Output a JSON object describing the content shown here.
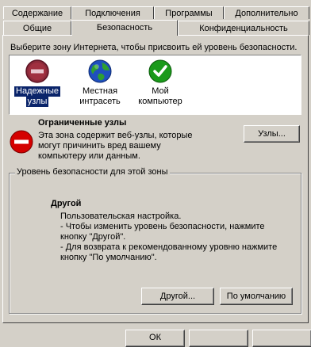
{
  "tabs_row1": [
    {
      "label": "Содержание"
    },
    {
      "label": "Подключения"
    },
    {
      "label": "Программы"
    },
    {
      "label": "Дополнительно"
    }
  ],
  "tabs_row2": [
    {
      "label": "Общие"
    },
    {
      "label": "Безопасность",
      "active": true
    },
    {
      "label": "Конфиденциальность"
    }
  ],
  "instruction": "Выберите зону Интернета, чтобы присвоить ей уровень безопасности.",
  "zones": [
    {
      "label_line1": "Надежные",
      "label_line2": "узлы",
      "icon": "restricted-sites-icon",
      "selected": true
    },
    {
      "label_line1": "Местная",
      "label_line2": "интрасеть",
      "icon": "globe-icon"
    },
    {
      "label_line1": "Мой",
      "label_line2": "компьютер",
      "icon": "checkmark-icon"
    }
  ],
  "zone_info": {
    "title": "Ограниченные узлы",
    "desc_line1": "Эта зона содержит веб-узлы, которые",
    "desc_line2": "могут причинить вред вашему",
    "desc_line3": "компьютеру или данным.",
    "sites_button": "Узлы..."
  },
  "security_level": {
    "group_title": "Уровень безопасности для этой зоны",
    "level_name": "Другой",
    "line1": "Пользовательская настройка.",
    "line2": "- Чтобы изменить уровень безопасности, нажмите",
    "line3": "кнопку \"Другой\".",
    "line4": "- Для возврата к рекомендованному уровню нажмите",
    "line5": "кнопку \"По умолчанию\".",
    "custom_button": "Другой...",
    "default_button": "По умолчанию"
  },
  "bottom_buttons": {
    "ok": "ОК"
  },
  "colors": {
    "face": "#d4d0c8",
    "selection": "#0a246a",
    "restricted_red": "#d40000",
    "globe_blue": "#1f4fbf",
    "globe_green": "#2fa02f",
    "check_green": "#1a9a1a"
  }
}
